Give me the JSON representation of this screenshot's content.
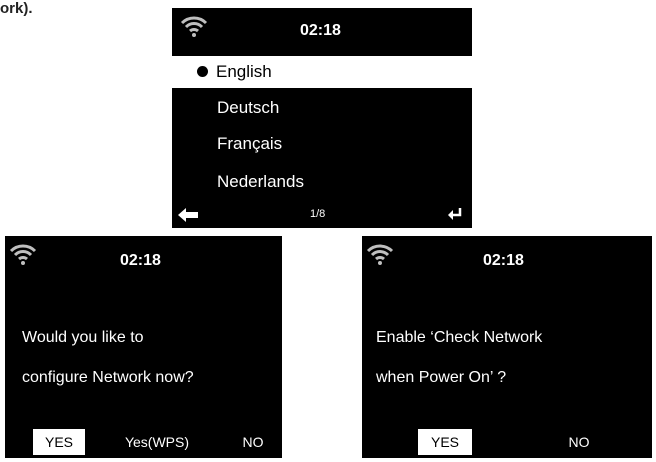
{
  "page_fragment": "ork).",
  "language_screen": {
    "time": "02:18",
    "items": [
      {
        "label": "English",
        "selected": true
      },
      {
        "label": "Deutsch",
        "selected": false
      },
      {
        "label": "Français",
        "selected": false
      },
      {
        "label": "Nederlands",
        "selected": false
      }
    ],
    "pager": "1/8",
    "icons": {
      "status": "wifi-icon",
      "back": "back-arrow-icon",
      "enter": "enter-icon"
    }
  },
  "network_screen": {
    "time": "02:18",
    "prompt_line1": "Would you like to",
    "prompt_line2": "configure Network now?",
    "buttons": {
      "yes": "YES",
      "wps": "Yes(WPS)",
      "no": "NO"
    },
    "selected_button": "YES"
  },
  "check_screen": {
    "time": "02:18",
    "prompt_line1": "Enable ‘Check Network",
    "prompt_line2": "when Power On’ ?",
    "buttons": {
      "yes": "YES",
      "no": "NO"
    },
    "selected_button": "YES"
  },
  "colors": {
    "screen_bg": "#000000",
    "text": "#ffffff",
    "highlight": "#ffffff",
    "wifi": "#bfbfbf"
  }
}
